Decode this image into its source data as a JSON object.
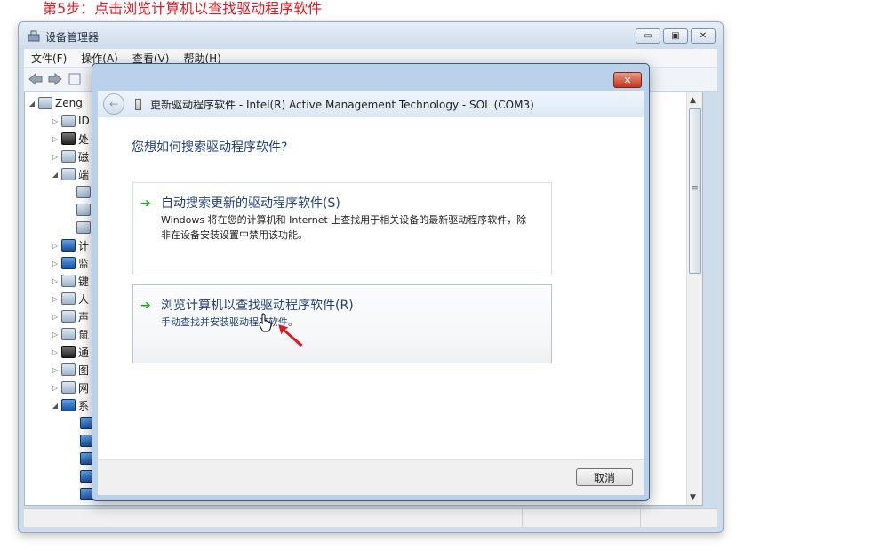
{
  "caption": "第5步：点击浏览计算机以查找驱动程序软件",
  "window": {
    "title": "设备管理器",
    "controls": {
      "minimize": "▭",
      "maximize": "▣",
      "close": "✕"
    }
  },
  "menu": [
    "文件(F)",
    "操作(A)",
    "查看(V)",
    "帮助(H)"
  ],
  "toolbar": {
    "back": "◆",
    "forward": "◆"
  },
  "tree": {
    "root": "Zeng",
    "items": [
      "ID",
      "处",
      "磁",
      "端",
      "",
      "",
      "",
      "计",
      "监",
      "键",
      "人",
      "声",
      "鼠",
      "通",
      "图",
      "网",
      "系",
      "",
      "",
      "",
      "",
      ""
    ]
  },
  "wizard": {
    "close_label": "✕",
    "back_label": "←",
    "header_title": "更新驱动程序软件 - Intel(R) Active Management Technology - SOL (COM3)",
    "question": "您想如何搜索驱动程序软件?",
    "option1": {
      "arrow": "➔",
      "title": "自动搜索更新的驱动程序软件(S)",
      "desc": "Windows 将在您的计算机和 Internet 上查找用于相关设备的最新驱动程序软件，除非在设备安装设置中禁用该功能。"
    },
    "option2": {
      "arrow": "➔",
      "title": "浏览计算机以查找驱动程序软件(R)",
      "desc": "手动查找并安装驱动程序软件。"
    },
    "cancel": "取消"
  },
  "colors": {
    "caption": "#e8141e",
    "link_blue": "#1f3f7a",
    "green_arrow": "#19a51c",
    "close_red": "#c4351c"
  }
}
